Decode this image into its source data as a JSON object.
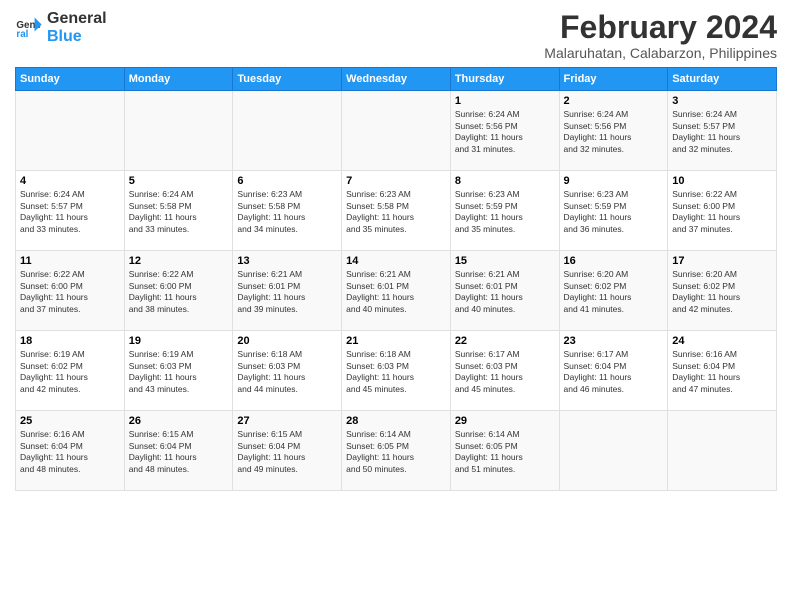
{
  "logo": {
    "line1": "General",
    "line2": "Blue"
  },
  "title": "February 2024",
  "subtitle": "Malaruhatan, Calabarzon, Philippines",
  "days_header": [
    "Sunday",
    "Monday",
    "Tuesday",
    "Wednesday",
    "Thursday",
    "Friday",
    "Saturday"
  ],
  "weeks": [
    [
      {
        "num": "",
        "info": ""
      },
      {
        "num": "",
        "info": ""
      },
      {
        "num": "",
        "info": ""
      },
      {
        "num": "",
        "info": ""
      },
      {
        "num": "1",
        "info": "Sunrise: 6:24 AM\nSunset: 5:56 PM\nDaylight: 11 hours\nand 31 minutes."
      },
      {
        "num": "2",
        "info": "Sunrise: 6:24 AM\nSunset: 5:56 PM\nDaylight: 11 hours\nand 32 minutes."
      },
      {
        "num": "3",
        "info": "Sunrise: 6:24 AM\nSunset: 5:57 PM\nDaylight: 11 hours\nand 32 minutes."
      }
    ],
    [
      {
        "num": "4",
        "info": "Sunrise: 6:24 AM\nSunset: 5:57 PM\nDaylight: 11 hours\nand 33 minutes."
      },
      {
        "num": "5",
        "info": "Sunrise: 6:24 AM\nSunset: 5:58 PM\nDaylight: 11 hours\nand 33 minutes."
      },
      {
        "num": "6",
        "info": "Sunrise: 6:23 AM\nSunset: 5:58 PM\nDaylight: 11 hours\nand 34 minutes."
      },
      {
        "num": "7",
        "info": "Sunrise: 6:23 AM\nSunset: 5:58 PM\nDaylight: 11 hours\nand 35 minutes."
      },
      {
        "num": "8",
        "info": "Sunrise: 6:23 AM\nSunset: 5:59 PM\nDaylight: 11 hours\nand 35 minutes."
      },
      {
        "num": "9",
        "info": "Sunrise: 6:23 AM\nSunset: 5:59 PM\nDaylight: 11 hours\nand 36 minutes."
      },
      {
        "num": "10",
        "info": "Sunrise: 6:22 AM\nSunset: 6:00 PM\nDaylight: 11 hours\nand 37 minutes."
      }
    ],
    [
      {
        "num": "11",
        "info": "Sunrise: 6:22 AM\nSunset: 6:00 PM\nDaylight: 11 hours\nand 37 minutes."
      },
      {
        "num": "12",
        "info": "Sunrise: 6:22 AM\nSunset: 6:00 PM\nDaylight: 11 hours\nand 38 minutes."
      },
      {
        "num": "13",
        "info": "Sunrise: 6:21 AM\nSunset: 6:01 PM\nDaylight: 11 hours\nand 39 minutes."
      },
      {
        "num": "14",
        "info": "Sunrise: 6:21 AM\nSunset: 6:01 PM\nDaylight: 11 hours\nand 40 minutes."
      },
      {
        "num": "15",
        "info": "Sunrise: 6:21 AM\nSunset: 6:01 PM\nDaylight: 11 hours\nand 40 minutes."
      },
      {
        "num": "16",
        "info": "Sunrise: 6:20 AM\nSunset: 6:02 PM\nDaylight: 11 hours\nand 41 minutes."
      },
      {
        "num": "17",
        "info": "Sunrise: 6:20 AM\nSunset: 6:02 PM\nDaylight: 11 hours\nand 42 minutes."
      }
    ],
    [
      {
        "num": "18",
        "info": "Sunrise: 6:19 AM\nSunset: 6:02 PM\nDaylight: 11 hours\nand 42 minutes."
      },
      {
        "num": "19",
        "info": "Sunrise: 6:19 AM\nSunset: 6:03 PM\nDaylight: 11 hours\nand 43 minutes."
      },
      {
        "num": "20",
        "info": "Sunrise: 6:18 AM\nSunset: 6:03 PM\nDaylight: 11 hours\nand 44 minutes."
      },
      {
        "num": "21",
        "info": "Sunrise: 6:18 AM\nSunset: 6:03 PM\nDaylight: 11 hours\nand 45 minutes."
      },
      {
        "num": "22",
        "info": "Sunrise: 6:17 AM\nSunset: 6:03 PM\nDaylight: 11 hours\nand 45 minutes."
      },
      {
        "num": "23",
        "info": "Sunrise: 6:17 AM\nSunset: 6:04 PM\nDaylight: 11 hours\nand 46 minutes."
      },
      {
        "num": "24",
        "info": "Sunrise: 6:16 AM\nSunset: 6:04 PM\nDaylight: 11 hours\nand 47 minutes."
      }
    ],
    [
      {
        "num": "25",
        "info": "Sunrise: 6:16 AM\nSunset: 6:04 PM\nDaylight: 11 hours\nand 48 minutes."
      },
      {
        "num": "26",
        "info": "Sunrise: 6:15 AM\nSunset: 6:04 PM\nDaylight: 11 hours\nand 48 minutes."
      },
      {
        "num": "27",
        "info": "Sunrise: 6:15 AM\nSunset: 6:04 PM\nDaylight: 11 hours\nand 49 minutes."
      },
      {
        "num": "28",
        "info": "Sunrise: 6:14 AM\nSunset: 6:05 PM\nDaylight: 11 hours\nand 50 minutes."
      },
      {
        "num": "29",
        "info": "Sunrise: 6:14 AM\nSunset: 6:05 PM\nDaylight: 11 hours\nand 51 minutes."
      },
      {
        "num": "",
        "info": ""
      },
      {
        "num": "",
        "info": ""
      }
    ]
  ]
}
